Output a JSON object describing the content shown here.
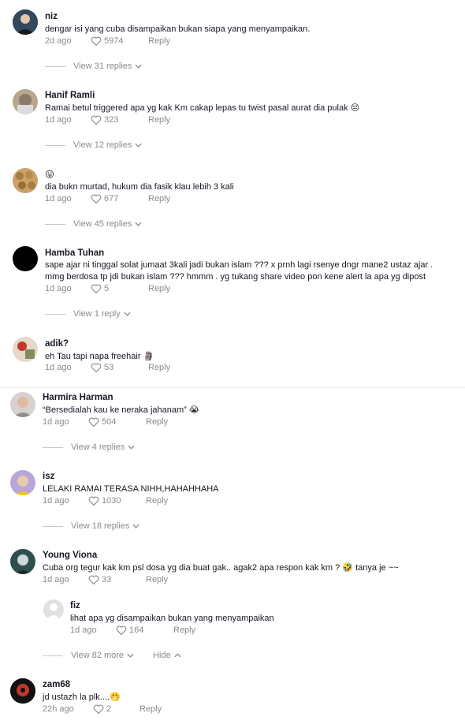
{
  "comments": [
    {
      "name": "niz",
      "text": "dengar isi yang cuba disampaikan bukan siapa yang menyampaikan.",
      "time": "2d ago",
      "likes": "5974",
      "reply": "Reply",
      "view": "View 31 replies"
    },
    {
      "name": "Hanif Ramli",
      "text": "Ramai betul triggered apa yg kak Km cakap lepas tu twist pasal aurat dia pulak",
      "emoji": "😔",
      "time": "1d ago",
      "likes": "323",
      "reply": "Reply",
      "view": "View 12 replies"
    },
    {
      "name": "😛",
      "text": "dia bukn murtad, hukum dia fasik klau lebih 3 kali",
      "time": "1d ago",
      "likes": "677",
      "reply": "Reply",
      "view": "View 45 replies"
    },
    {
      "name": "Hamba Tuhan",
      "text": "sape ajar ni tinggal solat jumaat 3kali jadi bukan islam ??? x prnh lagi rsenye dngr mane2 ustaz ajar .",
      "text2": "mmg berdosa tp jdi bukan islam ??? hmmm . yg tukang share video pon kene alert la apa yg dipost",
      "time": "1d ago",
      "likes": "5",
      "reply": "Reply",
      "view": "View 1 reply"
    },
    {
      "name": "adik?",
      "text": "eh Tau tapi napa freehair",
      "emoji": "🗿",
      "time": "1d ago",
      "likes": "53",
      "reply": "Reply"
    },
    {
      "name": "Harmira Harman",
      "text": "“Bersedialah kau ke neraka jahanam”",
      "emoji": "😭",
      "time": "1d ago",
      "likes": "504",
      "reply": "Reply",
      "view": "View 4 replies"
    },
    {
      "name": "isz",
      "text": "LELAKI RAMAI TERASA NIHH,HAHAHHAHA",
      "time": "1d ago",
      "likes": "1030",
      "reply": "Reply",
      "view": "View 18 replies"
    },
    {
      "name": "Young Viona",
      "text": "Cuba org tegur kak km psl dosa yg dia buat gak.. agak2 apa respon kak km ?",
      "emoji": "🤣",
      "text_after": "tanya je ~~",
      "time": "1d ago",
      "likes": "33",
      "reply": "Reply"
    },
    {
      "name": "fiz",
      "text": "lihat apa yg disampaikan bukan yang menyampaikan",
      "time": "1d ago",
      "likes": "164",
      "reply": "Reply",
      "view": "View 82 more",
      "hide": "Hide"
    },
    {
      "name": "zam68",
      "text": "jd ustazh la plk....",
      "emoji": "🤭",
      "time": "22h ago",
      "likes": "2",
      "reply": "Reply"
    }
  ],
  "colors": {
    "text": "#161823",
    "muted": "#8a8b91",
    "line": "#c9c9cc"
  }
}
